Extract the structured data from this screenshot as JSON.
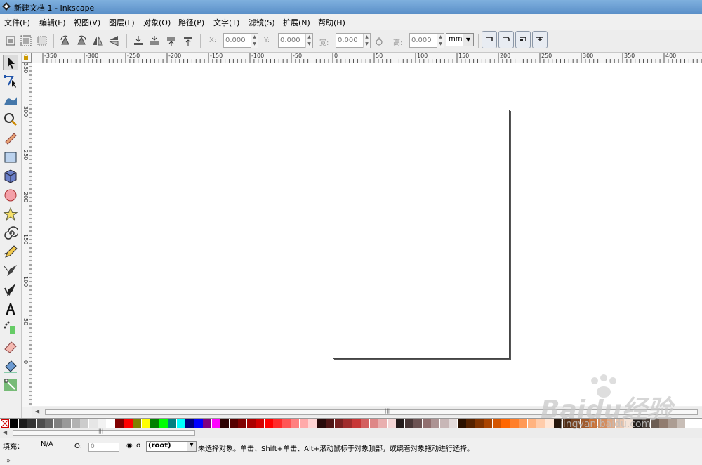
{
  "window": {
    "title": "新建文档 1 - Inkscape"
  },
  "menu": [
    "文件(F)",
    "编辑(E)",
    "视图(V)",
    "图层(L)",
    "对象(O)",
    "路径(P)",
    "文字(T)",
    "滤镜(S)",
    "扩展(N)",
    "帮助(H)"
  ],
  "toolbar": {
    "x_label": "X:",
    "x_value": "0.000",
    "y_label": "Y:",
    "y_value": "0.000",
    "w_label": "宽:",
    "w_value": "0.000",
    "h_label": "高:",
    "h_value": "0.000",
    "unit": "mm"
  },
  "ruler": {
    "h_ticks": [
      "-350",
      "-300",
      "-250",
      "-200",
      "-150",
      "-100",
      "-50",
      "0",
      "50",
      "100",
      "150",
      "200",
      "250",
      "300",
      "350",
      "400"
    ],
    "v_ticks": [
      "350",
      "300",
      "250",
      "200",
      "150",
      "100",
      "50",
      "0"
    ]
  },
  "status": {
    "fill_label": "填充：",
    "fill_value": "N/A",
    "opacity_label": "O:",
    "opacity_value": "0",
    "layer": "(root)",
    "message": "未选择对象。单击、Shift+单击、Alt+滚动鼠标于对象顶部，或绕着对象拖动进行选择。"
  },
  "palette_colors": [
    "#000000",
    "#1a1a1a",
    "#333333",
    "#4d4d4d",
    "#666666",
    "#808080",
    "#999999",
    "#b3b3b3",
    "#cccccc",
    "#e6e6e6",
    "#f2f2f2",
    "#ffffff",
    "#800000",
    "#ff0000",
    "#808000",
    "#ffff00",
    "#008000",
    "#00ff00",
    "#008080",
    "#00ffff",
    "#000080",
    "#0000ff",
    "#800080",
    "#ff00ff",
    "#2b0000",
    "#550000",
    "#800000",
    "#aa0000",
    "#d40000",
    "#ff0000",
    "#ff2a2a",
    "#ff5555",
    "#ff8080",
    "#ffaaaa",
    "#ffd5d5",
    "#280b0b",
    "#501616",
    "#782121",
    "#a02c2c",
    "#c83737",
    "#d35f5f",
    "#de8787",
    "#e9afaf",
    "#f4d7d7",
    "#241c1c",
    "#483737",
    "#6c5353",
    "#916f6f",
    "#ac9393",
    "#c8b7b7",
    "#e3dbdb",
    "#2b1100",
    "#552200",
    "#803300",
    "#aa4400",
    "#d45500",
    "#ff6600",
    "#ff7f2a",
    "#ff9955",
    "#ffb380",
    "#ffccaa",
    "#ffe6d5",
    "#28170b",
    "#502d16",
    "#784421",
    "#a05a2c",
    "#c87137",
    "#d38d5f",
    "#dea987",
    "#e9c6af",
    "#f4e3d7",
    "#241f1c",
    "#483e37",
    "#6c5d53",
    "#917c6f",
    "#ac9d93",
    "#c8beb7"
  ],
  "watermark": {
    "text": "Baidu经验",
    "url": "jingyan.baidu.com"
  }
}
